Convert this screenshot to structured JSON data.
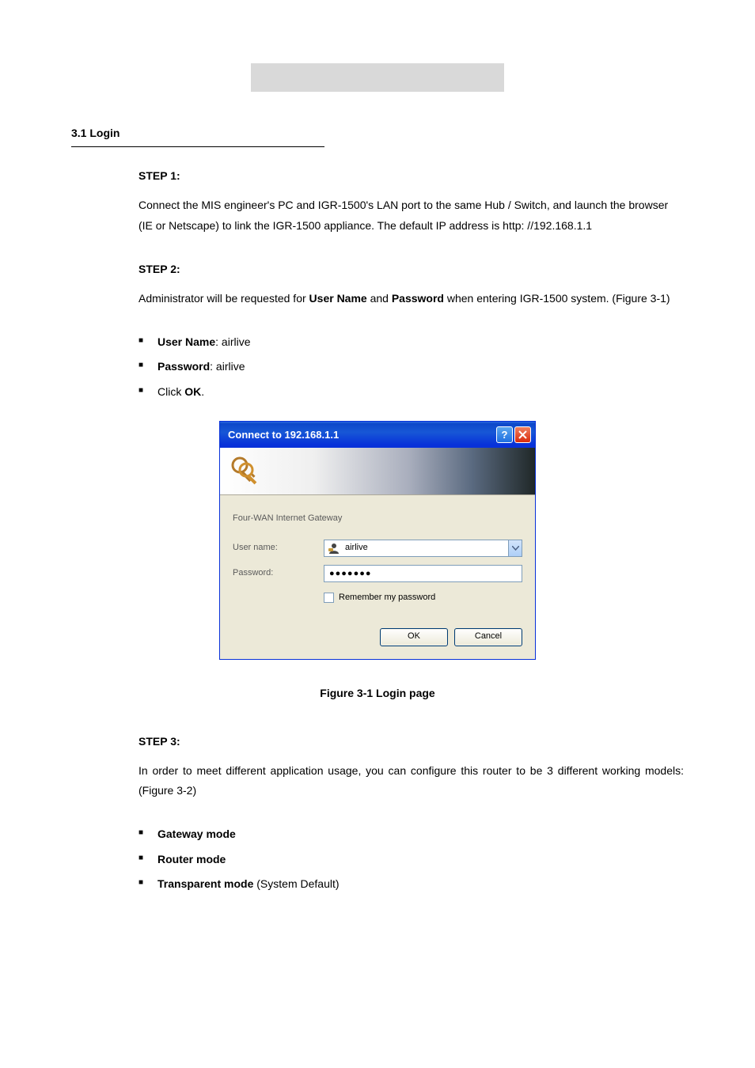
{
  "section_title": "3.1 Login",
  "step1": {
    "title": "STEP 1:",
    "body": "Connect the MIS engineer's PC and IGR-1500's LAN port to the same Hub / Switch, and launch the browser (IE or Netscape) to link the IGR-1500 appliance. The default IP address is http: //192.168.1.1"
  },
  "step2": {
    "title": "STEP 2:",
    "body_before": "Administrator will be requested for ",
    "body_un": "User Name",
    "body_mid1": " and ",
    "body_pw": "Password",
    "body_mid2": " when entering IGR-1500 system. (Figure 3-1)",
    "bullets": {
      "un_label": "User Name",
      "un_value": ": airlive",
      "pw_label": "Password",
      "pw_value": ": airlive",
      "click_pre": "Click ",
      "click_bold": "OK",
      "click_post": "."
    }
  },
  "dialog": {
    "title": "Connect to 192.168.1.1",
    "subtitle": "Four-WAN Internet Gateway",
    "labels": {
      "username": "User name:",
      "password": "Password:",
      "remember": "Remember my password"
    },
    "values": {
      "username": "airlive",
      "password": "●●●●●●●"
    },
    "buttons": {
      "ok": "OK",
      "cancel": "Cancel"
    }
  },
  "fig_caption": "Figure 3-1 Login page",
  "step3": {
    "title": "STEP 3:",
    "body": "In order to meet different application usage, you can configure this router to be 3 different working models: (Figure 3-2)",
    "bullets": {
      "b1": "Gateway mode",
      "b2": "Router mode",
      "b3_pre": "Transparent mode",
      "b3_post": " (System Default)"
    }
  }
}
